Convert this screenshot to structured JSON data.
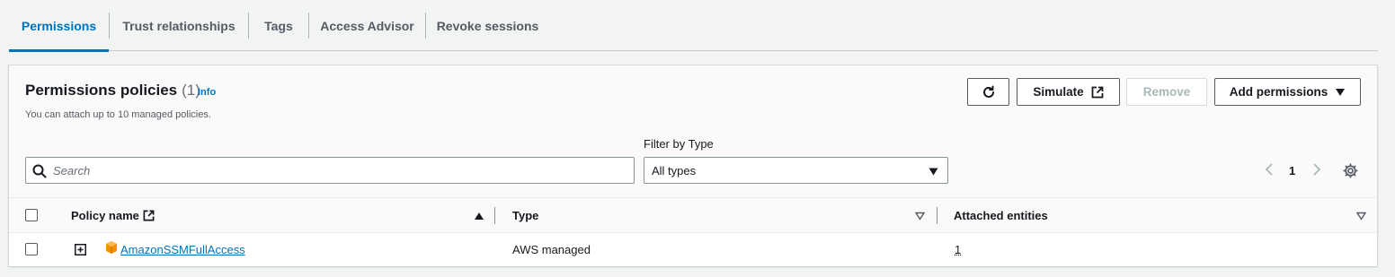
{
  "tabs": [
    {
      "label": "Permissions",
      "active": true
    },
    {
      "label": "Trust relationships",
      "active": false
    },
    {
      "label": "Tags",
      "active": false
    },
    {
      "label": "Access Advisor",
      "active": false
    },
    {
      "label": "Revoke sessions",
      "active": false
    }
  ],
  "header": {
    "title": "Permissions policies",
    "count": "(1)",
    "info_label": "Info",
    "description": "You can attach up to 10 managed policies."
  },
  "actions": {
    "refresh_icon": "refresh-icon",
    "simulate_label": "Simulate",
    "remove_label": "Remove",
    "add_permissions_label": "Add permissions"
  },
  "filter": {
    "search_placeholder": "Search",
    "type_label": "Filter by Type",
    "type_value": "All types"
  },
  "pagination": {
    "current_page": "1"
  },
  "table": {
    "columns": [
      "Policy name",
      "Type",
      "Attached entities"
    ],
    "rows": [
      {
        "policy_name": "AmazonSSMFullAccess",
        "type": "AWS managed",
        "attached_entities": "1"
      }
    ]
  },
  "colors": {
    "accent": "#0073bb",
    "policy_icon": "#f29100"
  }
}
